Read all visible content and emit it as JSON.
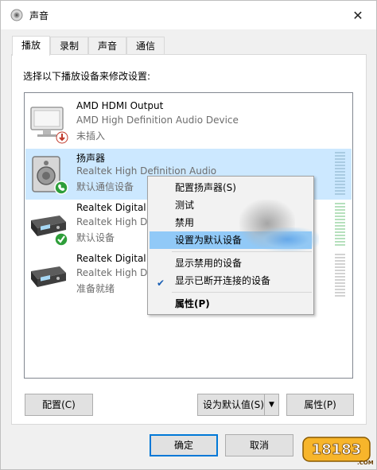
{
  "window": {
    "title": "声音",
    "close_glyph": "✕"
  },
  "tabs": [
    {
      "label": "播放",
      "active": true
    },
    {
      "label": "录制",
      "active": false
    },
    {
      "label": "声音",
      "active": false
    },
    {
      "label": "通信",
      "active": false
    }
  ],
  "instruction": "选择以下播放设备来修改设置:",
  "devices": [
    {
      "name": "AMD HDMI Output",
      "description": "AMD High Definition Audio Device",
      "status": "未插入",
      "icon": "monitor-icon",
      "badge": "unplugged-badge-icon",
      "selected": false
    },
    {
      "name": "扬声器",
      "description": "Realtek High Definition Audio",
      "status": "默认通信设备",
      "icon": "speaker-icon",
      "badge": "phone-badge-icon",
      "selected": true
    },
    {
      "name": "Realtek Digital",
      "description": "Realtek High D",
      "status": "默认设备",
      "icon": "digital-output-icon",
      "badge": "check-badge-icon",
      "selected": false
    },
    {
      "name": "Realtek Digital",
      "description": "Realtek High D",
      "status": "准备就绪",
      "icon": "digital-output-icon",
      "badge": "",
      "selected": false
    }
  ],
  "context_menu": {
    "items": [
      {
        "label": "配置扬声器(S)",
        "checked": false,
        "highlighted": false,
        "bold": false
      },
      {
        "label": "测试",
        "checked": false,
        "highlighted": false,
        "bold": false
      },
      {
        "label": "禁用",
        "checked": false,
        "highlighted": false,
        "bold": false
      },
      {
        "label": "设置为默认设备",
        "checked": false,
        "highlighted": true,
        "bold": false
      },
      {
        "label": "显示禁用的设备",
        "checked": false,
        "highlighted": false,
        "bold": false
      },
      {
        "label": "显示已断开连接的设备",
        "checked": true,
        "highlighted": false,
        "bold": false
      },
      {
        "label": "属性(P)",
        "checked": false,
        "highlighted": false,
        "bold": true
      }
    ]
  },
  "buttons": {
    "configure": "配置(C)",
    "set_default": "设为默认值(S)",
    "properties": "属性(P)",
    "ok": "确定",
    "cancel": "取消"
  },
  "watermark": {
    "text": "18183",
    "sub": ".COM"
  },
  "colors": {
    "selection": "#cce8ff",
    "menu_highlight": "#91c9f7",
    "accent": "#0078d7"
  }
}
